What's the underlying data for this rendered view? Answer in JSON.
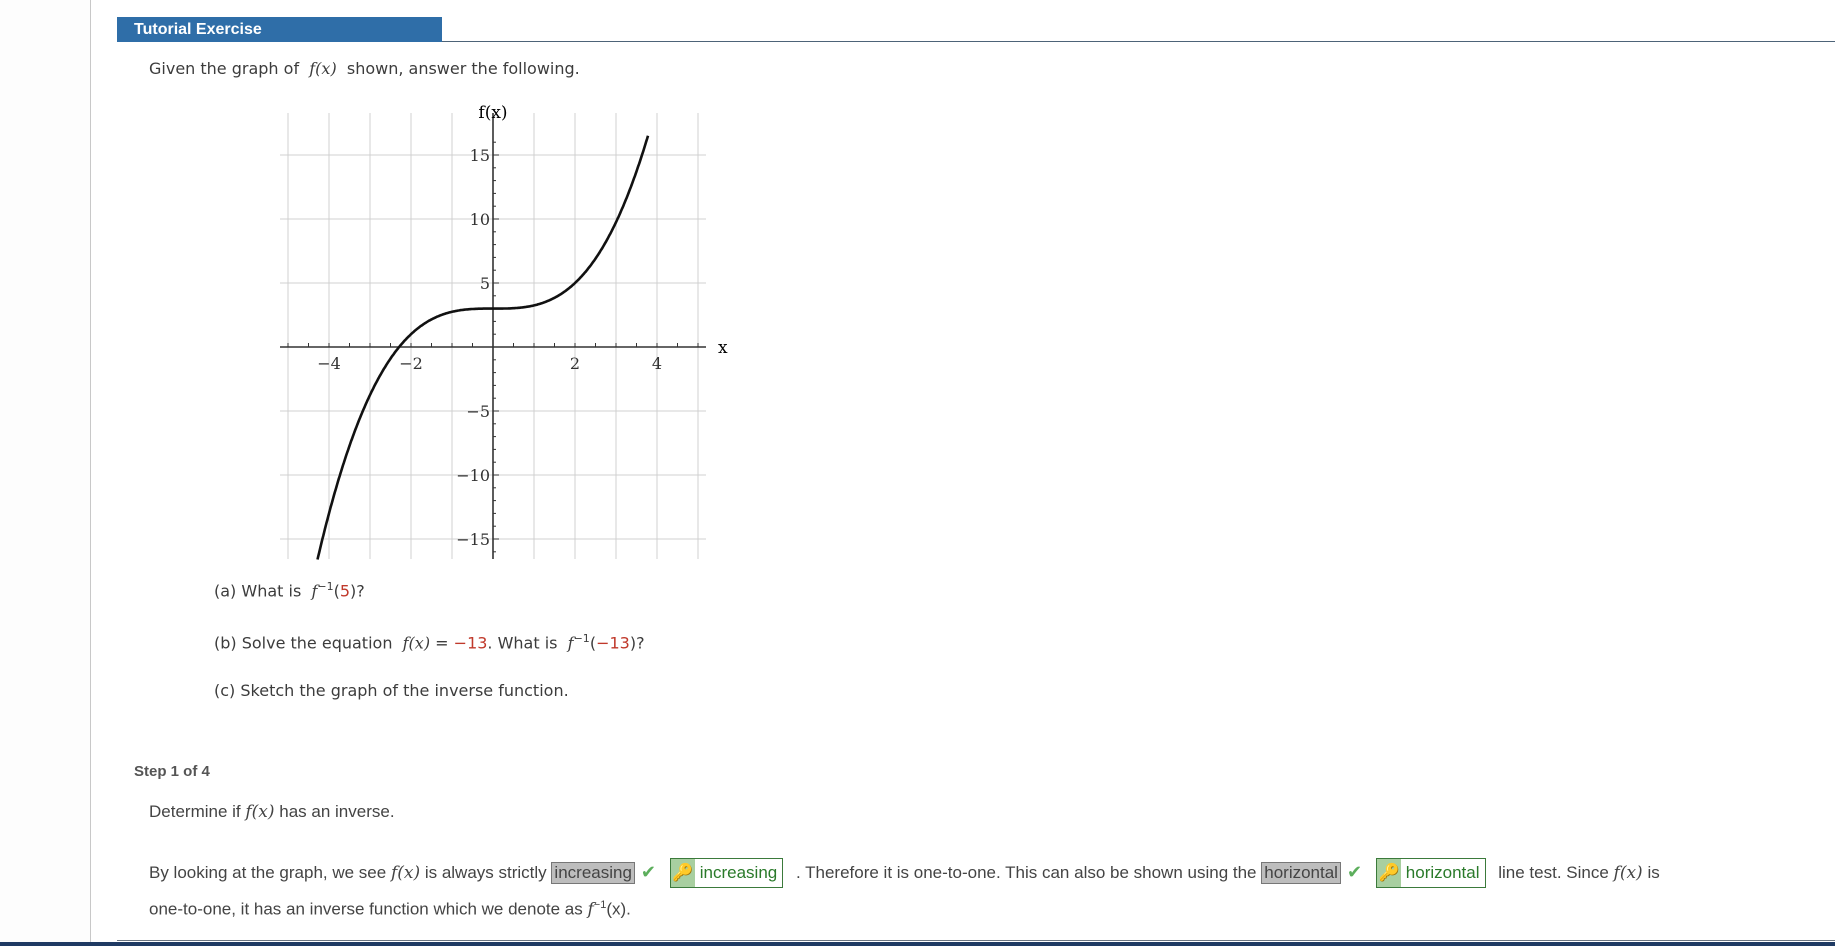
{
  "header": {
    "title": "Tutorial Exercise"
  },
  "intro": {
    "prefix": "Given the graph of",
    "func": "f(x)",
    "suffix": "shown, answer the following."
  },
  "chart_data": {
    "type": "line",
    "title": "",
    "xlabel": "x",
    "ylabel": "f(x)",
    "function": "x^3/4 + 3",
    "xlim": [
      -5.2,
      5.2
    ],
    "ylim": [
      -16.7,
      16.7
    ],
    "xticks": [
      -4,
      -2,
      2,
      4
    ],
    "xtick_labels": [
      "−4",
      "−2",
      "2",
      "4"
    ],
    "yticks": [
      15,
      10,
      5,
      -5,
      -10,
      -15
    ],
    "ytick_labels": [
      "15",
      "10",
      "5",
      "−5",
      "−10",
      "−15"
    ],
    "x_grid": [
      -5,
      -4,
      -3,
      -2,
      -1,
      1,
      2,
      3,
      4,
      5
    ],
    "y_grid": [
      15,
      10,
      5,
      -5,
      -10,
      -15
    ],
    "grid": true,
    "series": [
      {
        "name": "f(x)",
        "x": [
          -4.2,
          -4,
          -3,
          -2.3,
          -2,
          -1,
          0,
          1,
          2,
          3,
          3.8
        ],
        "values": [
          -15.52,
          -13,
          -3.75,
          -0.04,
          1,
          2.75,
          3,
          3.25,
          5,
          9.75,
          16.72
        ]
      }
    ]
  },
  "questions": {
    "a": {
      "label": "(a) What is",
      "fn": "f",
      "sup": "−1",
      "open": "(",
      "arg": "5",
      "close": ")?"
    },
    "b": {
      "label": "(b) Solve the equation",
      "fx": "f(x)",
      "eq": "=",
      "val": "−13",
      "mid": ". What is",
      "fn": "f",
      "sup": "−1",
      "open": "(",
      "arg": "−13",
      "close": ")?"
    },
    "c": {
      "label": "(c) Sketch the graph of the inverse function."
    }
  },
  "step": {
    "label": "Step 1 of 4",
    "prompt_pre": "Determine if",
    "prompt_fx": "f(x)",
    "prompt_post": "has an inverse.",
    "line1_pre": "By looking at the graph, we see",
    "fx": "f(x)",
    "line1_mid": "is always strictly",
    "answer1": "increasing",
    "key1": "increasing",
    "line1_mid2": ". Therefore it is one-to-one. This can also be shown using the",
    "answer2": "horizontal",
    "key2": "horizontal",
    "line1_end": "line test. Since",
    "line1_end2": "is",
    "line2_pre": "one-to-one, it has an inverse function which we denote as",
    "inv_fn": "f",
    "inv_sup": "−1",
    "inv_arg": "(x)."
  },
  "colors": {
    "header": "#2f6ea8",
    "highlight": "#c0392b",
    "correct": "#5cae5c"
  }
}
